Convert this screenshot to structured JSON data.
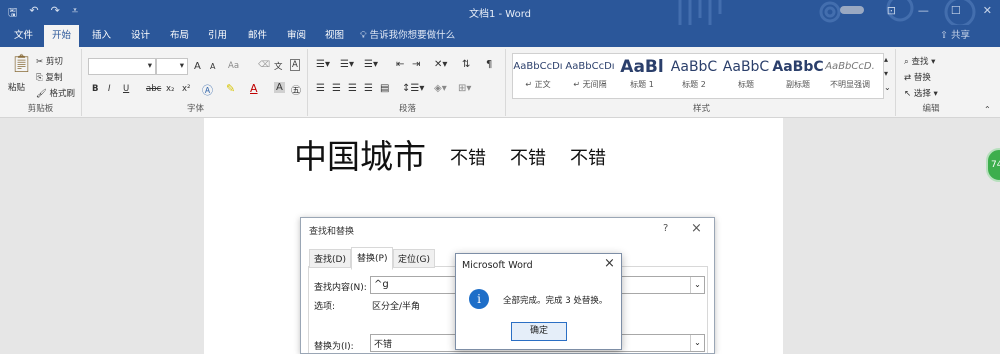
{
  "titlebar": {
    "title": "文档1 - Word",
    "qat_icons": [
      "save-icon",
      "undo-icon",
      "redo-icon",
      "customize-icon"
    ],
    "window_buttons": [
      "restore-ribbon-icon",
      "minimize-icon",
      "maximize-icon",
      "close-icon"
    ]
  },
  "tabs": [
    {
      "label": "文件"
    },
    {
      "label": "开始"
    },
    {
      "label": "插入"
    },
    {
      "label": "设计"
    },
    {
      "label": "布局"
    },
    {
      "label": "引用"
    },
    {
      "label": "邮件"
    },
    {
      "label": "审阅"
    },
    {
      "label": "视图"
    }
  ],
  "tell_me": "告诉我你想要做什么",
  "share": "共享",
  "clipboard": {
    "paste": "粘贴",
    "cut": "剪切",
    "copy": "复制",
    "format_painter": "格式刷",
    "label": "剪贴板"
  },
  "font": {
    "label": "字体",
    "grow": "A",
    "shrink": "A",
    "case": "Aa",
    "bold": "B",
    "italic": "I",
    "underline": "U",
    "strike": "abc",
    "sub": "x₂",
    "sup": "x²"
  },
  "paragraph": {
    "label": "段落"
  },
  "styles": {
    "label": "样式",
    "items": [
      {
        "sample": "AaBbCcDı",
        "name": "↵ 正文"
      },
      {
        "sample": "AaBbCcDı",
        "name": "↵ 无间隔"
      },
      {
        "sample": "AaBl",
        "name": "标题 1"
      },
      {
        "sample": "AaBbC",
        "name": "标题 2"
      },
      {
        "sample": "AaBbC",
        "name": "标题"
      },
      {
        "sample": "AaBbC",
        "name": "副标题"
      },
      {
        "sample": "AaBbCcD.",
        "name": "不明显强调"
      }
    ]
  },
  "editing": {
    "label": "编辑",
    "find": "查找",
    "replace": "替换",
    "select": "选择"
  },
  "document": {
    "heading": "中国城市",
    "words": [
      "不错",
      "不错",
      "不错"
    ]
  },
  "find_replace": {
    "title": "查找和替换",
    "help": "?",
    "close": "×",
    "tabs": [
      "查找(D)",
      "替换(P)",
      "定位(G)"
    ],
    "find_label": "查找内容(N):",
    "find_value": "^g",
    "options_label": "选项:",
    "options_value": "区分全/半角",
    "replace_label": "替换为(I):",
    "replace_value": "不错"
  },
  "messagebox": {
    "title": "Microsoft Word",
    "close": "×",
    "icon": "i",
    "message": "全部完成。完成 3 处替换。",
    "ok": "确定"
  },
  "side_badge": "74",
  "colors": {
    "brand": "#2b579a",
    "ribbon": "#f3f3f3",
    "canvas": "#e6e6e6"
  }
}
